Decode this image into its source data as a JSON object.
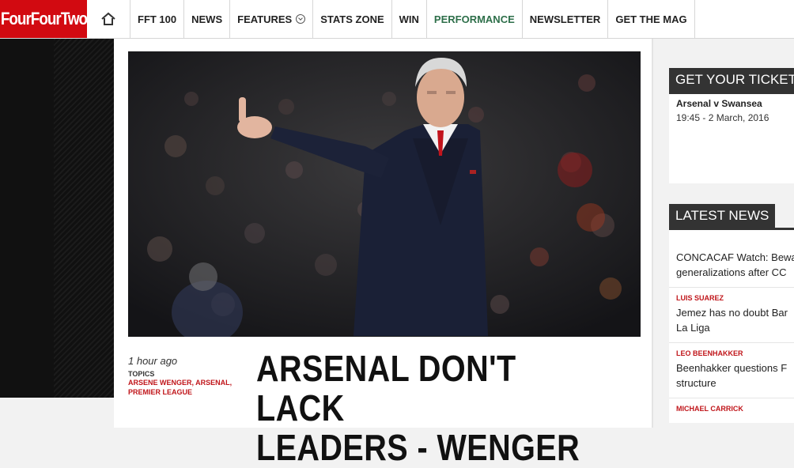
{
  "logo": {
    "text": "FourFourTwo"
  },
  "nav": {
    "home_icon": "home-icon",
    "items": [
      {
        "label": "FFT 100"
      },
      {
        "label": "NEWS"
      },
      {
        "label": "FEATURES",
        "has_dropdown": true
      },
      {
        "label": "STATS ZONE"
      },
      {
        "label": "WIN"
      },
      {
        "label": "PERFORMANCE",
        "color": "#2e6f4a"
      },
      {
        "label": "NEWSLETTER"
      },
      {
        "label": "GET THE MAG"
      }
    ]
  },
  "article": {
    "time": "1 hour ago",
    "topics_label": "TOPICS",
    "topics": "ARSENE WENGER, ARSENAL, PREMIER LEAGUE",
    "headline_line1": "ARSENAL DON'T LACK",
    "headline_line2": "LEADERS - WENGER"
  },
  "sidebar": {
    "tickets": {
      "heading": "GET YOUR TICKETS",
      "match": "Arsenal v Swansea",
      "when": "19:45 - 2 March, 2016"
    },
    "latest": {
      "heading": "LATEST NEWS",
      "items": [
        {
          "category": "",
          "title_line1": "CONCACAF Watch: Bewa",
          "title_line2": "generalizations after CC"
        },
        {
          "category": "LUIS SUAREZ",
          "title_line1": "Jemez has no doubt Bar",
          "title_line2": "La Liga"
        },
        {
          "category": "LEO BEENHAKKER",
          "title_line1": "Beenhakker questions F",
          "title_line2": "structure"
        },
        {
          "category": "MICHAEL CARRICK",
          "title_line1": "",
          "title_line2": ""
        }
      ]
    }
  },
  "colors": {
    "brand_red": "#d20a11",
    "topic_red": "#c0151a",
    "performance_green": "#2e6f4a"
  }
}
